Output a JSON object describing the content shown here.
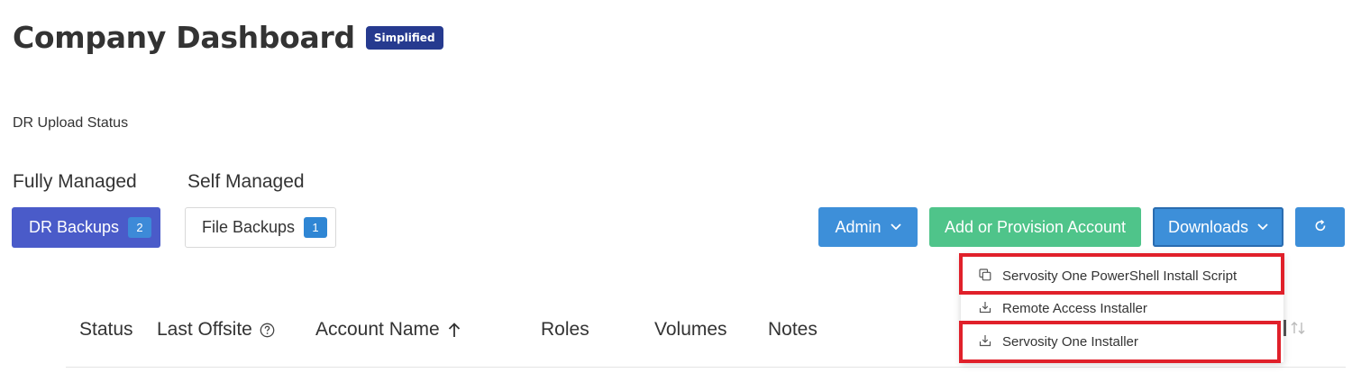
{
  "header": {
    "title": "Company Dashboard",
    "badge": "Simplified"
  },
  "dr_upload_status": "DR Upload Status",
  "groups": {
    "fully_managed": "Fully Managed",
    "self_managed": "Self Managed"
  },
  "tabs": {
    "dr_backups": {
      "label": "DR Backups",
      "count": "2"
    },
    "file_backups": {
      "label": "File Backups",
      "count": "1"
    }
  },
  "toolbar": {
    "admin_label": "Admin",
    "add_label": "Add or Provision Account",
    "downloads_label": "Downloads",
    "refresh_icon": "refresh-icon"
  },
  "downloads_menu": {
    "items": [
      {
        "label": "Servosity One PowerShell Install Script",
        "icon": "copy-icon",
        "highlighted": true
      },
      {
        "label": "Remote Access Installer",
        "icon": "download-icon",
        "highlighted": false
      },
      {
        "label": "Servosity One Installer",
        "icon": "download-icon",
        "highlighted": true
      }
    ]
  },
  "table": {
    "columns": [
      "Status",
      "Last Offsite",
      "Account Name",
      "Roles",
      "Volumes",
      "Notes"
    ],
    "sorted_column": "Account Name",
    "sort_direction": "ascending"
  },
  "colors": {
    "primary_blue": "#3d8fd9",
    "indigo": "#4a5bc9",
    "green": "#4fc48a",
    "badge_navy": "#263a8f",
    "highlight_red": "#e0202a"
  }
}
